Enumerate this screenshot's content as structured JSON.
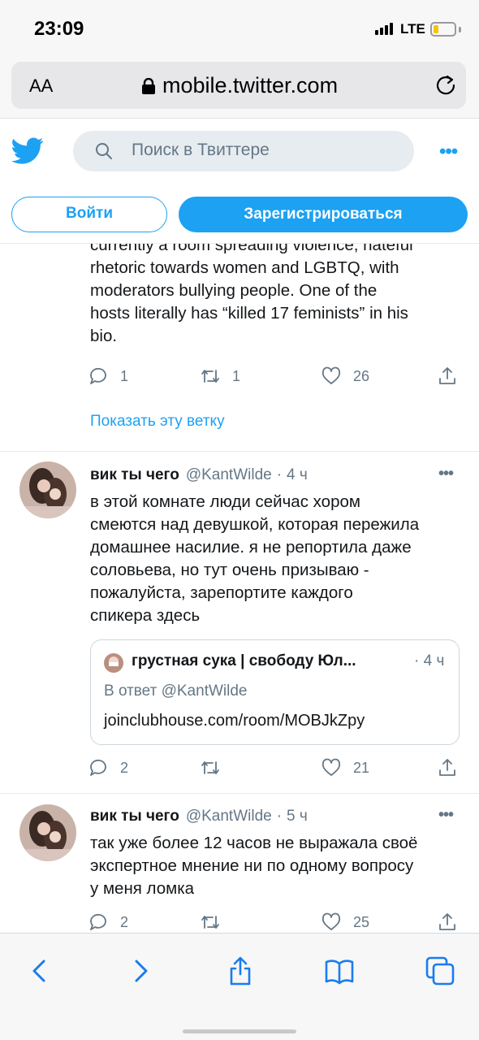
{
  "status_bar": {
    "time": "23:09",
    "network": "LTE",
    "battery_level": 0.25
  },
  "browser": {
    "text_size_label": "AA",
    "url": "mobile.twitter.com"
  },
  "twitter": {
    "search_placeholder": "Поиск в Твиттере",
    "login_label": "Войти",
    "signup_label": "Зарегистрироваться",
    "more_label": "•••"
  },
  "feed": {
    "partial_tweet": {
      "lines": [
        "currently a room spreading violence, hateful",
        "rhetoric towards women and LGBTQ, with",
        "moderators bullying people. One of the",
        "hosts literally has “killed 17 feminists” in his",
        "bio."
      ],
      "replies": "1",
      "retweets": "1",
      "likes": "26",
      "show_thread": "Показать эту ветку"
    },
    "tweets": [
      {
        "name": "вик ты чего",
        "handle": "@KantWilde",
        "dot": "·",
        "time": "4 ч",
        "lines": [
          "в этой комнате люди сейчас хором",
          "смеются над девушкой, которая пережила",
          "домашнее насилие. я не репортила даже",
          "соловьева, но тут очень призываю -",
          "пожалуйста, зарепортите каждого",
          "спикера здесь"
        ],
        "quote": {
          "name": "грустная сука | свободу Юл...",
          "time": "· 4 ч",
          "reply_to": "В ответ @KantWilde",
          "link": "joinclubhouse.com/room/MOBJkZpy"
        },
        "replies": "2",
        "retweets": "",
        "likes": "21"
      },
      {
        "name": "вик ты чего",
        "handle": "@KantWilde",
        "dot": "·",
        "time": "5 ч",
        "lines": [
          "так уже более 12 часов не выражала своё",
          "экспертное мнение ни по одному вопросу",
          "у меня ломка"
        ],
        "replies": "2",
        "retweets": "",
        "likes": "25"
      }
    ]
  },
  "colors": {
    "accent": "#1da1f2",
    "muted": "#657786",
    "text": "#14171a",
    "divider": "#e6ecf0"
  }
}
